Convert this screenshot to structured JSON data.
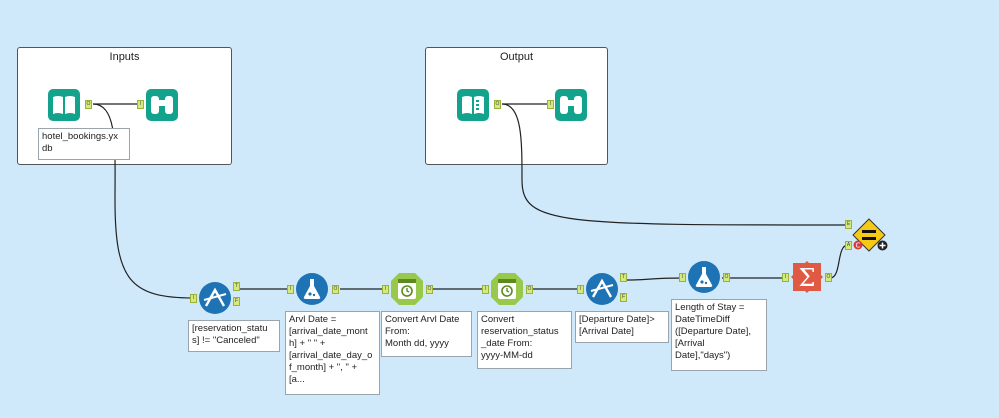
{
  "containers": {
    "inputs_title": "Inputs",
    "output_title": "Output"
  },
  "annotations": {
    "input_file": "hotel_bookings.yx\ndb",
    "filter_status": "[reservation_statu\ns] != \"Canceled\"",
    "formula_arrival": "Arvl Date =\n[arrival_date_mont\nh] + \" \" +\n[arrival_date_day_o\nf_month] + \", \" +\n[a...",
    "datetime_arrival": "Convert Arvl Date\nFrom:\nMonth dd, yyyy",
    "datetime_status": "Convert\nreservation_status\n_date From:\nyyyy-MM-dd",
    "filter_departure": "[Departure Date]>\n[Arrival Date]",
    "formula_stay": "Length of Stay =\nDateTimeDiff\n([Departure Date],\n[Arrival\nDate],\"days\")"
  },
  "anchors": {
    "true": "T",
    "false": "F",
    "input": "I",
    "output": "O",
    "expected": "E",
    "actual": "A"
  },
  "icons": {
    "input": "book-input-icon",
    "browse": "binoculars-browse-icon",
    "filter": "filter-triangle-icon",
    "formula": "flask-formula-icon",
    "datetime": "clock-datetime-icon",
    "summarize": "sigma-summarize-icon",
    "test": "equals-test-icon"
  },
  "colors": {
    "canvas": "#cfe9fb",
    "input_output": "#13a38c",
    "preparation": "#1e73b5",
    "parse": "#98c94c",
    "transform": "#e05a43",
    "developer": "#f5c916"
  }
}
